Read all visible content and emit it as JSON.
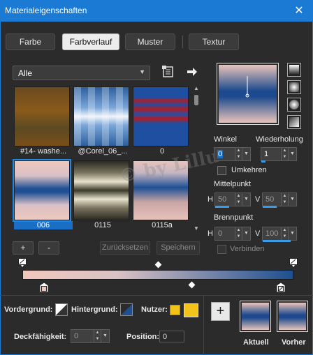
{
  "window": {
    "title": "Materialeigenschaften",
    "close_glyph": "✕"
  },
  "tabs": [
    {
      "label": "Farbe",
      "active": false
    },
    {
      "label": "Farbverlauf",
      "active": true
    },
    {
      "label": "Muster",
      "active": false
    },
    {
      "label": "Textur",
      "active": false
    }
  ],
  "category_select": {
    "value": "Alle",
    "icon": "chevron-down-icon"
  },
  "library_icon": "book-icon",
  "forward_icon": "arrow-right-icon",
  "gradients": [
    {
      "label": "#14- washe...",
      "selected": false
    },
    {
      "label": "@Corel_06_...",
      "selected": false
    },
    {
      "label": "0",
      "selected": false
    },
    {
      "label": "006",
      "selected": true
    },
    {
      "label": "0115",
      "selected": false
    },
    {
      "label": "0115a",
      "selected": false
    }
  ],
  "buttons": {
    "add": "+",
    "remove": "-",
    "reset": "Zurücksetzen",
    "save": "Speichern"
  },
  "angle": {
    "label": "Winkel",
    "value": "0"
  },
  "repeat": {
    "label": "Wiederholung",
    "value": "1"
  },
  "invert": {
    "label": "Umkehren",
    "checked": false
  },
  "midpoint": {
    "label": "Mittelpunkt",
    "h_label": "H",
    "h_value": "50",
    "v_label": "V",
    "v_value": "50"
  },
  "focal": {
    "label": "Brennpunkt",
    "h_label": "H",
    "h_value": "0",
    "v_label": "V",
    "v_value": "100"
  },
  "link": {
    "label": "Verbinden",
    "checked": false
  },
  "bottom": {
    "foreground_label": "Vordergrund:",
    "background_label": "Hintergrund:",
    "user_label": "Nutzer:",
    "opacity_label": "Deckfähigkeit:",
    "opacity_value": "0",
    "position_label": "Position:",
    "position_value": "0",
    "current_label": "Aktuell",
    "previous_label": "Vorher"
  },
  "watermark_text": "© by Lillu",
  "colors": {
    "accent": "#1a7ad4",
    "gradient_start": "#f1c7bd",
    "gradient_end": "#1e4f8f",
    "user_color": "#f2c31a"
  }
}
